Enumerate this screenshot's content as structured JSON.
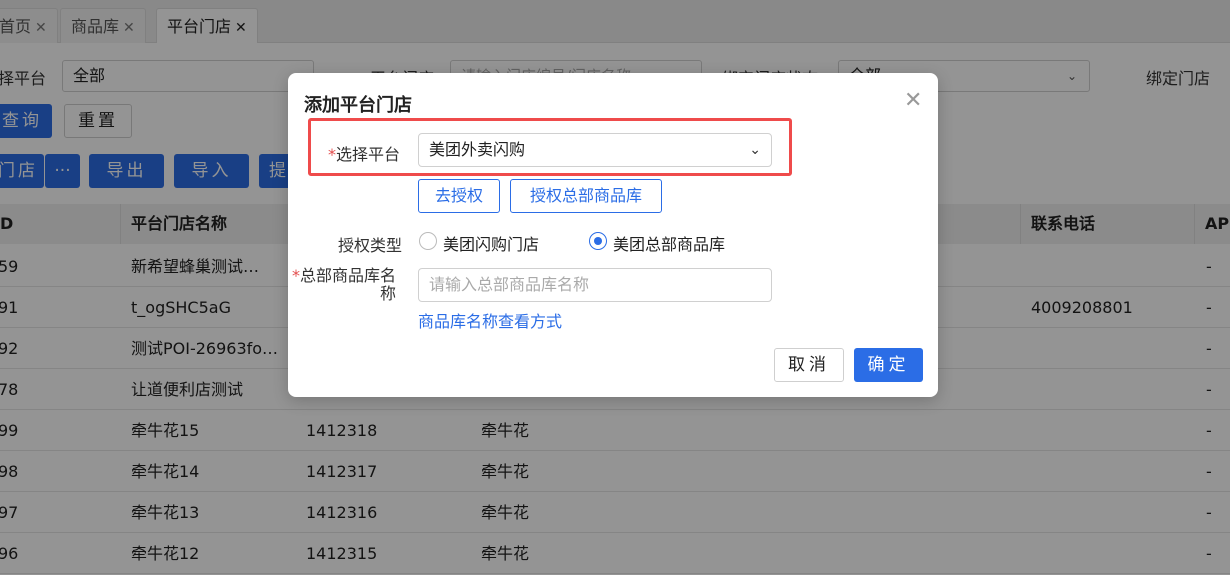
{
  "tabs": [
    {
      "label": "首页",
      "close": "✕"
    },
    {
      "label": "商品库",
      "close": "✕"
    },
    {
      "label": "平台门店",
      "close": "✕"
    }
  ],
  "filters": {
    "platform_label": "择平台",
    "platform_value": "全部",
    "store_label": "平台门店",
    "store_placeholder": "请输入门店编号/门店名称",
    "bind_status_label": "绑定门店状态",
    "bind_status_value": "全部",
    "bind_store_label": "绑定门店"
  },
  "actions": {
    "query": "查询",
    "reset": "重置",
    "store_btn": "门店",
    "more": "···",
    "export": "导出",
    "import": "导入",
    "submit_partial": "提"
  },
  "table": {
    "headers": [
      "D",
      "平台门店名称",
      "联系电话",
      "AP"
    ],
    "rows": [
      {
        "id": "59",
        "name": "新希望蜂巢测试…",
        "code": "",
        "brand": "",
        "phone": "",
        "ap": "-"
      },
      {
        "id": "91",
        "name": "t_ogSHC5aG",
        "code": "",
        "brand": "",
        "phone": "4009208801",
        "ap": "-"
      },
      {
        "id": "92",
        "name": "测试POI-26963fo…",
        "code": "",
        "brand": "",
        "phone": "",
        "ap": "-"
      },
      {
        "id": "78",
        "name": "让道便利店测试",
        "code": "",
        "brand": "",
        "phone": "",
        "ap": "-"
      },
      {
        "id": "99",
        "name": "牵牛花15",
        "code": "1412318",
        "brand": "牵牛花",
        "phone": "",
        "ap": "-"
      },
      {
        "id": "98",
        "name": "牵牛花14",
        "code": "1412317",
        "brand": "牵牛花",
        "phone": "",
        "ap": "-"
      },
      {
        "id": "97",
        "name": "牵牛花13",
        "code": "1412316",
        "brand": "牵牛花",
        "phone": "",
        "ap": "-"
      },
      {
        "id": "96",
        "name": "牵牛花12",
        "code": "1412315",
        "brand": "牵牛花",
        "phone": "",
        "ap": "-"
      }
    ]
  },
  "modal": {
    "title": "添加平台门店",
    "close": "✕",
    "required_mark": "*",
    "platform_label": "选择平台",
    "platform_value": "美团外卖闪购",
    "authorize_btn": "去授权",
    "authorize_hq_btn": "授权总部商品库",
    "auth_type_label": "授权类型",
    "auth_options": [
      "美团闪购门店",
      "美团总部商品库"
    ],
    "auth_selected_index": 1,
    "hq_name_label_line1": "总部商品库名",
    "hq_name_label_line2": "称",
    "hq_name_placeholder": "请输入总部商品库名称",
    "hq_name_link": "商品库名称查看方式",
    "cancel": "取消",
    "confirm": "确定"
  },
  "colors": {
    "primary": "#2b6de6",
    "highlight_border": "#ef4b4b",
    "required": "#e34d4d"
  }
}
